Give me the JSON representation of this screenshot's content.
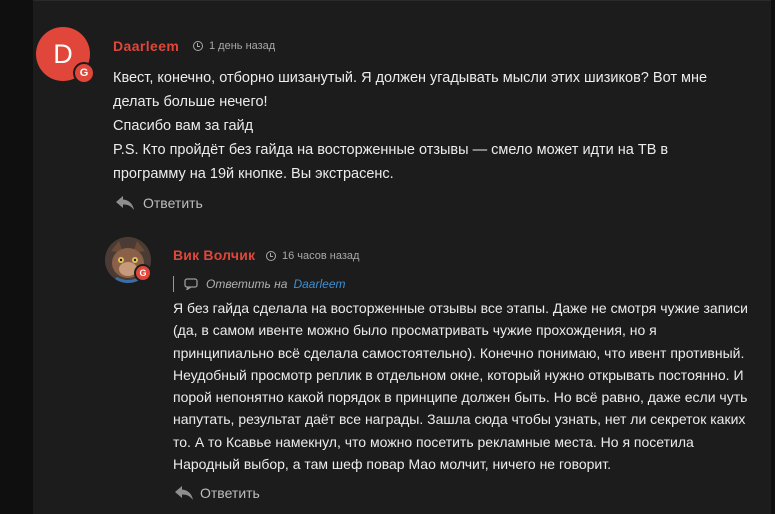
{
  "comments": [
    {
      "avatar_letter": "D",
      "avatar_color": "#e0463a",
      "badge": "G",
      "author": "Daarleem",
      "time": "1 день назад",
      "body": [
        "Квест, конечно, отборно шизанутый. Я должен угадывать мысли этих шизиков? Вот мне",
        "делать больше нечего!",
        "Спасибо вам за гайд",
        "P.S. Кто пройдёт без гайда на восторженные отзывы — смело может идти на ТВ в",
        "программу на 19й кнопке. Вы экстрасенс."
      ],
      "reply_label": "Ответить"
    },
    {
      "badge": "G",
      "author": "Вик Волчик",
      "time": "16 часов назад",
      "reply_to_prefix": "Ответить на",
      "reply_to_name": "Daarleem",
      "body": [
        "Я без гайда сделала на восторженные отзывы все этапы. Даже не смотря чужие записи",
        "(да, в самом ивенте можно было просматривать чужие прохождения, но я",
        "принципиально всё сделала самостоятельно). Конечно понимаю, что ивент противный.",
        "Неудобный просмотр реплик в отдельном окне, который нужно открывать постоянно. И",
        "порой непонятно какой порядок в принципе должен быть. Но всё равно, даже если чуть",
        "напутать, результат даёт все награды. Зашла сюда чтобы узнать, нет ли секреток каких",
        "то. А то Ксавье намекнул, что можно посетить рекламные места. Но я посетила",
        "Народный выбор, а там шеф повар Мао молчит, ничего не говорит."
      ],
      "reply_label": "Ответить"
    }
  ],
  "colors": {
    "accent": "#e0463a",
    "link": "#3d8fd1",
    "background": "#1c1c1c"
  }
}
